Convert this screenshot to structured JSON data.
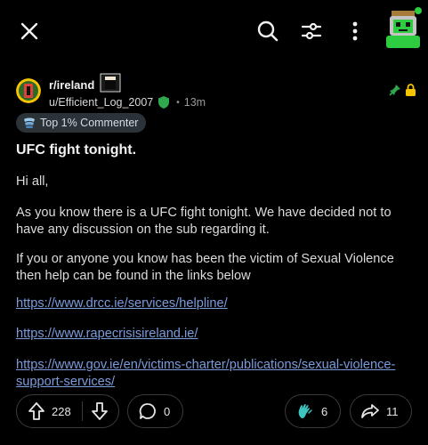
{
  "topbar": {
    "close_icon": "close-icon",
    "search_icon": "search-icon",
    "filter_icon": "sliders-icon",
    "more_icon": "more-vertical-icon",
    "avatar_icon": "user-avatar"
  },
  "post": {
    "subreddit": "r/ireland",
    "author": "u/Efficient_Log_2007",
    "time": "13m",
    "badge": "Top 1% Commenter",
    "title": "UFC fight tonight.",
    "paragraphs": [
      "Hi all,",
      "As you know there is a UFC fight tonight. We have decided not to have any discussion on the sub regarding it.",
      "If you or anyone you know has been the victim of Sexual Violence then help can be found in the links below"
    ],
    "links": [
      "https://www.drcc.ie/services/helpline/",
      "https://www.rapecrisisireland.ie/",
      "https://www.gov.ie/en/victims-charter/publications/sexual-violence-support-services/"
    ]
  },
  "actions": {
    "score": "228",
    "comments": "0",
    "awards": "6",
    "shares": "11"
  },
  "colors": {
    "background": "#000000",
    "link": "#7c9bdc",
    "mod_green": "#2fa84f",
    "lock_yellow": "#f5c400",
    "badge_bg": "#2b3338"
  }
}
